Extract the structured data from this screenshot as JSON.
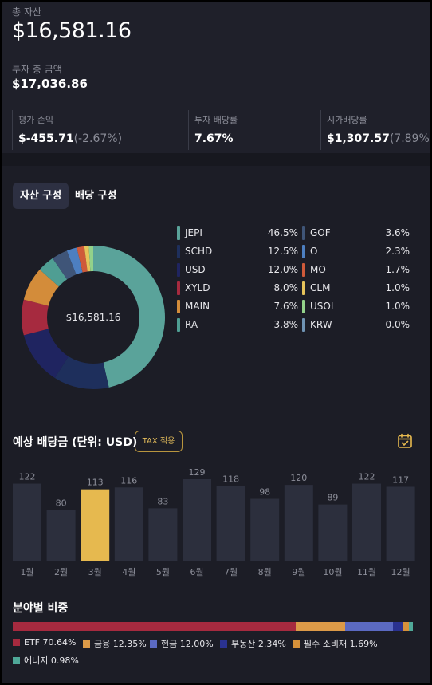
{
  "summary": {
    "total_assets_label": "총 자산",
    "total_assets_value": "$16,581.16",
    "invested_label": "투자 총 금액",
    "invested_value": "$17,036.86",
    "stats": [
      {
        "label": "평가 손익",
        "value": "$-455.71",
        "sub": "(-2.67%)"
      },
      {
        "label": "투자 배당률",
        "value": "7.67%",
        "sub": ""
      },
      {
        "label": "시가배당률",
        "value": "$1,307.57",
        "sub": "(7.89%)"
      }
    ]
  },
  "tabs": [
    {
      "label": "자산 구성",
      "active": true
    },
    {
      "label": "배당 구성",
      "active": false
    }
  ],
  "composition": {
    "center_label": "$16,581.16",
    "items": [
      {
        "name": "JEPI",
        "pct": "46.5%",
        "value": 46.5,
        "color": "#5aa39a"
      },
      {
        "name": "SCHD",
        "pct": "12.5%",
        "value": 12.5,
        "color": "#1e2f5c"
      },
      {
        "name": "USD",
        "pct": "12.0%",
        "value": 12.0,
        "color": "#1f2460"
      },
      {
        "name": "XYLD",
        "pct": "8.0%",
        "value": 8.0,
        "color": "#a62a3f"
      },
      {
        "name": "MAIN",
        "pct": "7.6%",
        "value": 7.6,
        "color": "#d38c3a"
      },
      {
        "name": "RA",
        "pct": "3.8%",
        "value": 3.8,
        "color": "#4f9e93"
      },
      {
        "name": "GOF",
        "pct": "3.6%",
        "value": 3.6,
        "color": "#3f5578"
      },
      {
        "name": "O",
        "pct": "2.3%",
        "value": 2.3,
        "color": "#4d7fc1"
      },
      {
        "name": "MO",
        "pct": "1.7%",
        "value": 1.7,
        "color": "#cf5a3a"
      },
      {
        "name": "CLM",
        "pct": "1.0%",
        "value": 1.0,
        "color": "#e6c35a"
      },
      {
        "name": "USOI",
        "pct": "1.0%",
        "value": 1.0,
        "color": "#93d28a"
      },
      {
        "name": "KRW",
        "pct": "0.0%",
        "value": 0.0,
        "color": "#6f93b3"
      }
    ]
  },
  "dividends": {
    "title": "예상 배당금 (단위: USD)",
    "tax_button": "TAX 적용",
    "calendar_icon": "calendar-check-icon",
    "highlight_color": "#e6b94f",
    "bar_color": "#2c2f3d"
  },
  "chart_data": {
    "type": "bar",
    "categories": [
      "1월",
      "2월",
      "3월",
      "4월",
      "5월",
      "6월",
      "7월",
      "8월",
      "9월",
      "10월",
      "11월",
      "12월"
    ],
    "values": [
      122,
      80,
      113,
      116,
      83,
      129,
      118,
      98,
      120,
      89,
      122,
      117
    ],
    "highlighted_index": 2,
    "title": "예상 배당금 (단위: USD)",
    "ylim": [
      0,
      129
    ]
  },
  "sectors": {
    "title": "분야별 비중",
    "items": [
      {
        "label": "ETF 70.64%",
        "value": 70.64,
        "color": "#a62a3f"
      },
      {
        "label": "금융 12.35%",
        "value": 12.35,
        "color": "#dc9a48"
      },
      {
        "label": "현금 12.00%",
        "value": 12.0,
        "color": "#5b6ac2"
      },
      {
        "label": "부동산 2.34%",
        "value": 2.34,
        "color": "#2a3290"
      },
      {
        "label": "필수 소비재 1.69%",
        "value": 1.69,
        "color": "#d6913a"
      },
      {
        "label": "에너지 0.98%",
        "value": 0.98,
        "color": "#4fa898"
      }
    ]
  }
}
